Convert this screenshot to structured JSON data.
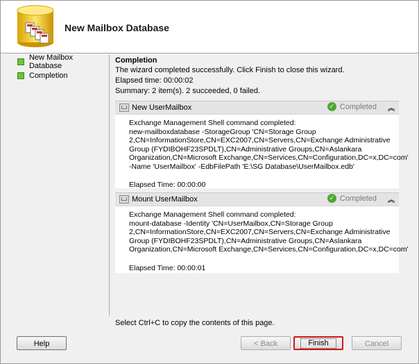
{
  "header": {
    "title": "New Mailbox Database"
  },
  "sidebar": {
    "items": [
      {
        "label": "New Mailbox Database"
      },
      {
        "label": "Completion"
      }
    ]
  },
  "content": {
    "title": "Completion",
    "message": "The wizard completed successfully. Click Finish to close this wizard.",
    "elapsed": "Elapsed time: 00:00:02",
    "summary": "Summary: 2 item(s). 2 succeeded, 0 failed."
  },
  "tasks": [
    {
      "name": "New UserMailbox",
      "status": "Completed",
      "body": "Exchange Management Shell command completed:\nnew-mailboxdatabase -StorageGroup 'CN=Storage Group\n2,CN=InformationStore,CN=EXC2007,CN=Servers,CN=Exchange Administrative\nGroup (FYDIBOHF23SPDLT),CN=Administrative Groups,CN=Aslankara\nOrganization,CN=Microsoft Exchange,CN=Services,CN=Configuration,DC=x,DC=com'\n-Name 'UserMailbox' -EdbFilePath 'E:\\SG Database\\UserMailbox.edb'",
      "elapsed": "Elapsed Time: 00:00:00"
    },
    {
      "name": "Mount UserMailbox",
      "status": "Completed",
      "body": "Exchange Management Shell command completed:\nmount-database -Identity 'CN=UserMailbox,CN=Storage Group\n2,CN=InformationStore,CN=EXC2007,CN=Servers,CN=Exchange Administrative\nGroup (FYDIBOHF23SPDLT),CN=Administrative Groups,CN=Aslankara\nOrganization,CN=Microsoft Exchange,CN=Services,CN=Configuration,DC=x,DC=com'",
      "elapsed": "Elapsed Time: 00:00:01"
    }
  ],
  "footer": {
    "copy_hint": "Select Ctrl+C to copy the contents of this page.",
    "help": "Help",
    "back": "< Back",
    "finish": "Finish",
    "cancel": "Cancel"
  },
  "colors": {
    "accent_red": "#d01818",
    "success_green": "#4ea832",
    "completion_square": "#6fc23a"
  }
}
